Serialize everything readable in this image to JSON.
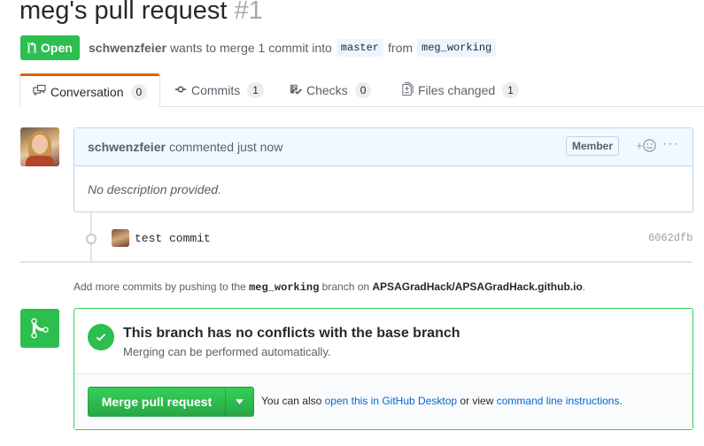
{
  "pr": {
    "title": "meg's pull request",
    "number": "#1",
    "state": "Open",
    "author": "schwenzfeier",
    "meta_text": "wants to merge 1 commit into",
    "base_branch": "master",
    "from_text": "from",
    "head_branch": "meg_working"
  },
  "tabs": [
    {
      "label": "Conversation",
      "count": "0",
      "icon": "comment-discussion-icon"
    },
    {
      "label": "Commits",
      "count": "1",
      "icon": "git-commit-icon"
    },
    {
      "label": "Checks",
      "count": "0",
      "icon": "checklist-icon"
    },
    {
      "label": "Files changed",
      "count": "1",
      "icon": "file-diff-icon"
    }
  ],
  "comment": {
    "author": "schwenzfeier",
    "action": "commented just now",
    "role": "Member",
    "reaction_icon": "smiley-icon",
    "body": "No description provided."
  },
  "commit": {
    "message": "test commit",
    "sha": "6062dfb"
  },
  "push_note": {
    "before": "Add more commits by pushing to the",
    "branch": "meg_working",
    "middle": "branch on",
    "repo": "APSAGradHack/APSAGradHack.github.io",
    "end": "."
  },
  "merge": {
    "title": "This branch has no conflicts with the base branch",
    "subtitle": "Merging can be performed automatically.",
    "button": "Merge pull request",
    "alt_prefix": "You can also",
    "alt_link1": "open this in GitHub Desktop",
    "alt_middle": "or view",
    "alt_link2": "command line instructions",
    "alt_end": "."
  },
  "colors": {
    "open_green": "#2cbe4e",
    "link_blue": "#0366d6",
    "tab_accent": "#e36209"
  }
}
